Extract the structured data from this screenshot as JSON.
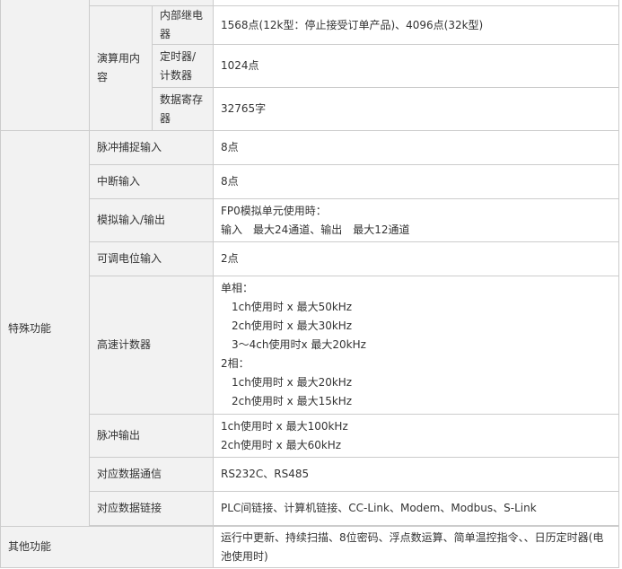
{
  "spec": {
    "calc_content": {
      "group_label": "演算用内容",
      "relay": {
        "label": "内部继电器",
        "value": "1568点(12k型：停止接受订单产品)、4096点(32k型)"
      },
      "timer": {
        "label": "定时器/计数器",
        "value": "1024点"
      },
      "data_register": {
        "label": "数据寄存器",
        "value": "32765字"
      }
    },
    "special": {
      "group_label": "特殊功能",
      "pulse_capture": {
        "label": "脉冲捕捉输入",
        "value": "8点"
      },
      "interrupt": {
        "label": "中断输入",
        "value": "8点"
      },
      "analog": {
        "label": "模拟输入/输出",
        "lines": [
          "FP0模拟单元使用時：",
          "输入　最大24通道、输出　最大12通道"
        ]
      },
      "potentiometer": {
        "label": "可调电位输入",
        "value": "2点"
      },
      "hsc": {
        "label": "高速计数器",
        "single_phase_title": "单相：",
        "single_phase": [
          "1ch使用时 x 最大50kHz",
          "2ch使用时 x 最大30kHz",
          "3～4ch使用时x 最大20kHz"
        ],
        "two_phase_title": "2相：",
        "two_phase": [
          "1ch使用时 x 最大20kHz",
          "2ch使用时 x 最大15kHz"
        ]
      },
      "pulse_output": {
        "label": "脉冲输出",
        "lines": [
          "1ch使用时 x 最大100kHz",
          "2ch使用时 x 最大60kHz"
        ]
      },
      "comm": {
        "label": "对应数据通信",
        "value": "RS232C、RS485"
      },
      "link": {
        "label": "对应数据链接",
        "value": "PLC间链接、计算机链接、CC-Link、Modem、Modbus、S-Link"
      }
    },
    "other": {
      "label": "其他功能",
      "value": "运行中更新、持续扫描、8位密码、浮点数运算、简单温控指令、、日历定时器(电池使用时)"
    }
  },
  "colors": {
    "label_bg": "#f2f2f2",
    "border": "#cccccc",
    "text": "#333333"
  }
}
